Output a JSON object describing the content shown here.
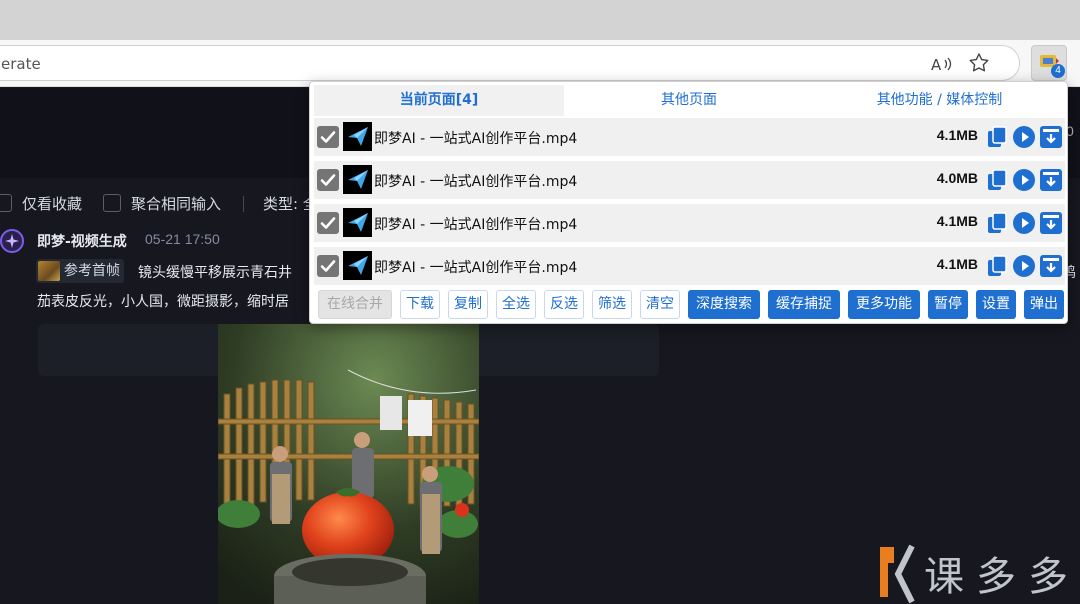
{
  "browser": {
    "url_fragment": "erate",
    "read_aloud_icon": "read-aloud-icon",
    "favorite_icon": "star-icon",
    "extension_badge": "4"
  },
  "page": {
    "top_right_text": "0",
    "filters": {
      "favorites_only": "仅看收藏",
      "merge_inputs": "聚合相同输入",
      "type_label": "类型: 全"
    },
    "post": {
      "author": "即梦-视频生成",
      "date": "05-21  17:50",
      "reference_tag": "参考首帧",
      "prompt_line1": "镜头缓慢平移展示青石井",
      "prompt_line1_tail": "鸡",
      "prompt_line2": "茄表皮反光，小人国，微距摄影，缩时居"
    }
  },
  "popup": {
    "tabs": [
      "当前页面[4]",
      "其他页面",
      "其他功能 / 媒体控制"
    ],
    "items": [
      {
        "name": "即梦AI - 一站式AI创作平台.mp4",
        "size": "4.1MB"
      },
      {
        "name": "即梦AI - 一站式AI创作平台.mp4",
        "size": "4.0MB"
      },
      {
        "name": "即梦AI - 一站式AI创作平台.mp4",
        "size": "4.1MB"
      },
      {
        "name": "即梦AI - 一站式AI创作平台.mp4",
        "size": "4.1MB"
      }
    ],
    "buttons": {
      "merge_online": "在线合并",
      "download": "下载",
      "copy": "复制",
      "select_all": "全选",
      "invert": "反选",
      "filter": "筛选",
      "clear": "清空",
      "deep_search": "深度搜索",
      "cache_capture": "缓存捕捉",
      "more": "更多功能",
      "pause": "暂停",
      "settings": "设置",
      "popup": "弹出"
    },
    "accent_color": "#1f6fd1"
  }
}
